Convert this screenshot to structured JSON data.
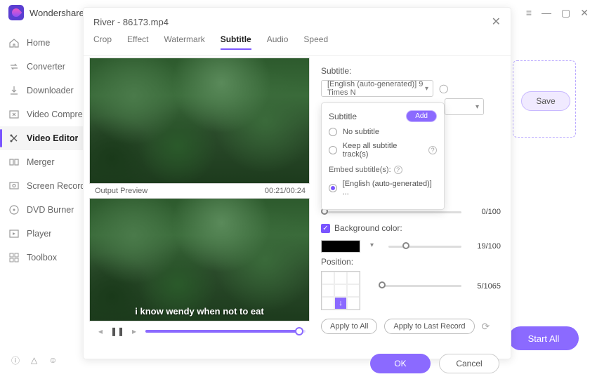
{
  "app": {
    "title": "Wondershare"
  },
  "sidebar": {
    "items": [
      {
        "label": "Home",
        "icon": "home-icon"
      },
      {
        "label": "Converter",
        "icon": "converter-icon"
      },
      {
        "label": "Downloader",
        "icon": "downloader-icon"
      },
      {
        "label": "Video Compre",
        "icon": "compress-icon"
      },
      {
        "label": "Video Editor",
        "icon": "editor-icon"
      },
      {
        "label": "Merger",
        "icon": "merger-icon"
      },
      {
        "label": "Screen Recorde",
        "icon": "recorder-icon"
      },
      {
        "label": "DVD Burner",
        "icon": "dvd-icon"
      },
      {
        "label": "Player",
        "icon": "player-icon"
      },
      {
        "label": "Toolbox",
        "icon": "toolbox-icon"
      }
    ],
    "active_index": 4
  },
  "right": {
    "save_label": "Save",
    "start_all_label": "Start All"
  },
  "modal": {
    "title": "River - 86173.mp4",
    "tabs": [
      "Crop",
      "Effect",
      "Watermark",
      "Subtitle",
      "Audio",
      "Speed"
    ],
    "active_tab": 3,
    "preview": {
      "label": "Output Preview",
      "time": "00:21/00:24",
      "subtitle_line": "i know wendy when not to eat"
    },
    "settings": {
      "subtitle_label": "Subtitle:",
      "subtitle_value": "[English (auto-generated)] 9 Times N",
      "bg_color_label": "Background color:",
      "bg_color_checked": true,
      "bg_color_value": "#000000",
      "opacity1": {
        "value": 0,
        "max": 100,
        "text": "0/100"
      },
      "opacity2": {
        "value": 19,
        "max": 100,
        "text": "19/100"
      },
      "position_label": "Position:",
      "position_slider": {
        "value": 5,
        "max": 1065,
        "text": "5/1065"
      },
      "apply_all": "Apply to All",
      "apply_last": "Apply to Last Record"
    },
    "footer": {
      "ok": "OK",
      "cancel": "Cancel"
    }
  },
  "popover": {
    "heading": "Subtitle",
    "add_label": "Add",
    "no_subtitle": "No subtitle",
    "keep_all": "Keep all subtitle track(s)",
    "embed_label": "Embed subtitle(s):",
    "embed_option": "[English (auto-generated)] ...",
    "selected": "embed"
  }
}
